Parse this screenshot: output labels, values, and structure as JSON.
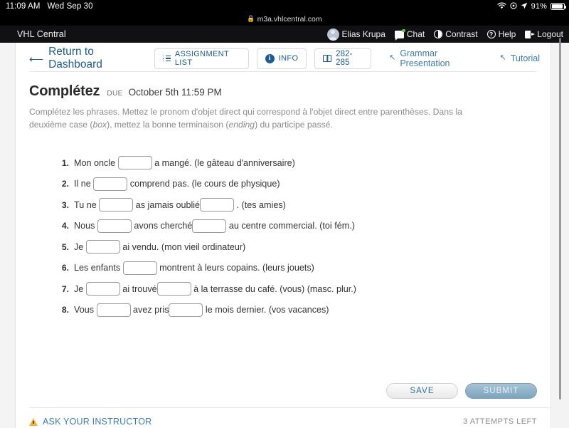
{
  "status_bar": {
    "time": "11:09 AM",
    "date": "Wed Sep 30",
    "wifi_icon": "wifi-icon",
    "location_icon": "location-arrow-icon",
    "battery_percent": "91%"
  },
  "browser": {
    "lock_icon": "lock-icon",
    "url": "m3a.vhlcentral.com"
  },
  "app_header": {
    "brand": "VHL Central",
    "user_name": "Elias Krupa",
    "chat_label": "Chat",
    "contrast_label": "Contrast",
    "help_label": "Help",
    "logout_label": "Logout"
  },
  "toolbar": {
    "return_label": "Return to Dashboard",
    "assignment_list_label": "ASSIGNMENT LIST",
    "info_label": "INFO",
    "pages_label": "282-285",
    "grammar_presentation_label": "Grammar Presentation",
    "tutorial_label": "Tutorial"
  },
  "activity": {
    "title": "Complétez",
    "due_label": "DUE",
    "due_date": "October 5th 11:59 PM",
    "instructions_line1": "Complétez les phrases. Mettez le pronom d'objet direct qui correspond à l'objet direct entre parenthèses. Dans la deuxième case",
    "instructions_line2_pre": "(",
    "instructions_line2_box": "box",
    "instructions_line2_mid": "), mettez la bonne terminaison (",
    "instructions_line2_ending": "ending",
    "instructions_line2_post": ") du participe passé."
  },
  "questions": [
    {
      "num": "1.",
      "parts": [
        "Mon oncle ",
        "BLANK",
        " a mangé. (le gâteau d'anniversaire)"
      ]
    },
    {
      "num": "2.",
      "parts": [
        "Il ne ",
        "BLANK",
        " comprend pas. (le cours de physique)"
      ]
    },
    {
      "num": "3.",
      "parts": [
        "Tu ne ",
        "BLANK",
        " as jamais oublié",
        "BLANK",
        " . (tes amies)"
      ]
    },
    {
      "num": "4.",
      "parts": [
        "Nous ",
        "BLANK",
        " avons cherché",
        "BLANK",
        " au centre commercial. (toi fém.)"
      ]
    },
    {
      "num": "5.",
      "parts": [
        "Je ",
        "BLANK",
        " ai vendu. (mon vieil ordinateur)"
      ]
    },
    {
      "num": "6.",
      "parts": [
        "Les enfants ",
        "BLANK",
        " montrent à leurs copains. (leurs jouets)"
      ]
    },
    {
      "num": "7.",
      "parts": [
        "Je ",
        "BLANK",
        " ai trouvé",
        "BLANK",
        " à la terrasse du café. (vous) (masc. plur.)"
      ]
    },
    {
      "num": "8.",
      "parts": [
        "Vous ",
        "BLANK",
        " avez pris",
        "BLANK",
        " le mois dernier. (vos vacances)"
      ]
    }
  ],
  "footer": {
    "save_label": "SAVE",
    "submit_label": "SUBMIT",
    "ask_instructor_label": "ASK YOUR INSTRUCTOR",
    "attempts_left": "3 ATTEMPTS LEFT"
  },
  "colors": {
    "link_blue": "#1d5c92",
    "muted_blue": "#3c7ca8",
    "submit_blue": "#7ba4bf",
    "warn_amber": "#f0b33c",
    "header_black": "#111113"
  }
}
